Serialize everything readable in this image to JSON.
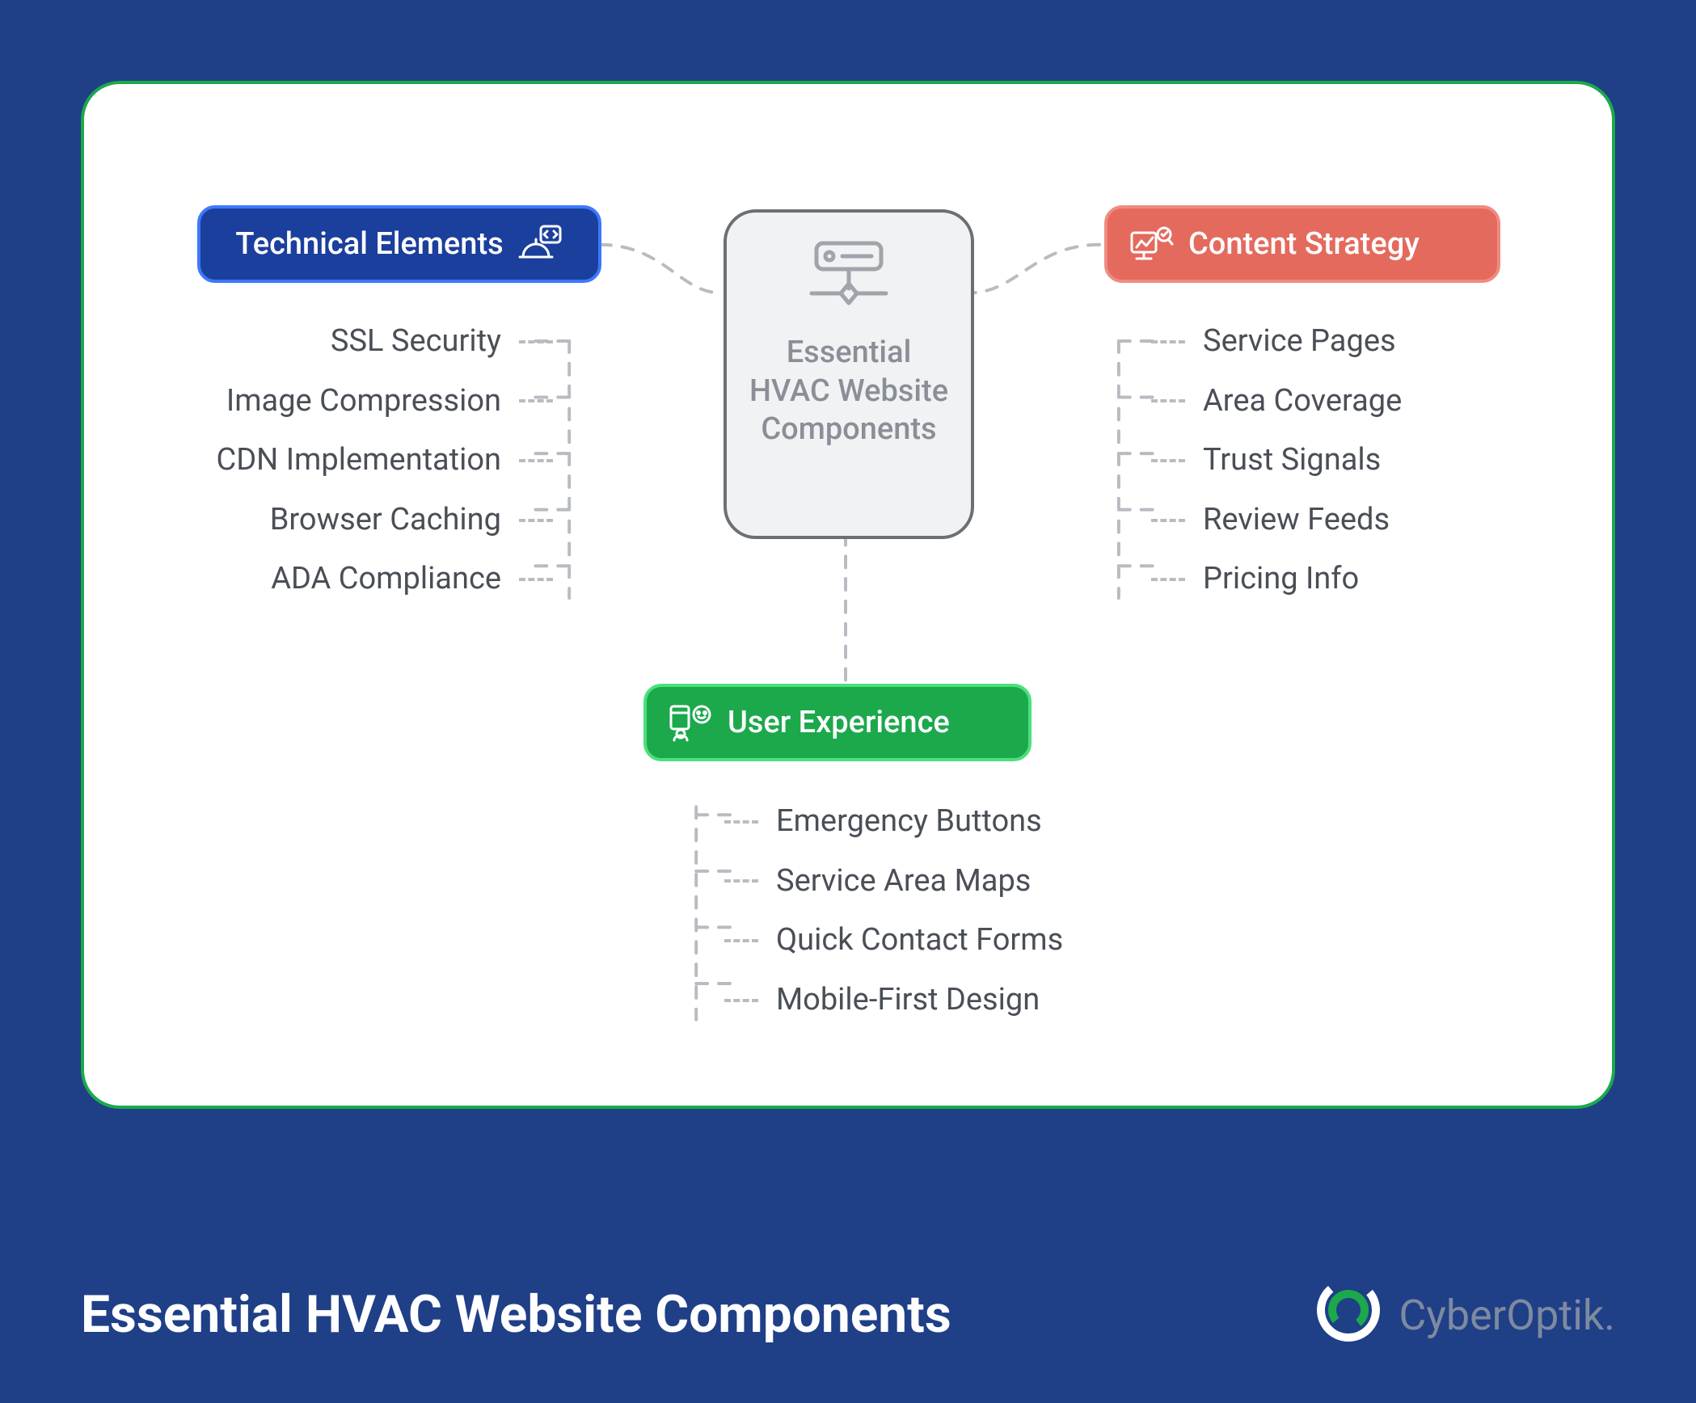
{
  "title": "Essential HVAC Website Components",
  "center": {
    "label": "Essential HVAC Website Components"
  },
  "categories": {
    "technical": {
      "title": "Technical Elements",
      "icon": "code-hardhat-icon",
      "items": [
        "SSL Security",
        "Image Compression",
        "CDN Implementation",
        "Browser Caching",
        "ADA Compliance"
      ]
    },
    "content": {
      "title": "Content Strategy",
      "icon": "presentation-insight-icon",
      "items": [
        "Service Pages",
        "Area Coverage",
        "Trust Signals",
        "Review Feeds",
        "Pricing Info"
      ]
    },
    "ux": {
      "title": "User Experience",
      "icon": "user-engagement-icon",
      "items": [
        "Emergency Buttons",
        "Service Area Maps",
        "Quick Contact Forms",
        "Mobile-First Design"
      ]
    }
  },
  "brand": {
    "name": "CyberOptik."
  }
}
